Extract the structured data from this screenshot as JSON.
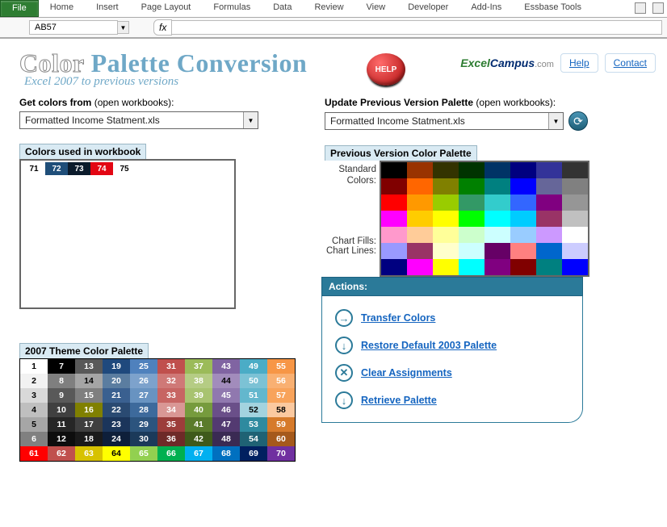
{
  "ribbon": {
    "tabs": [
      "File",
      "Home",
      "Insert",
      "Page Layout",
      "Formulas",
      "Data",
      "Review",
      "View",
      "Developer",
      "Add-Ins",
      "Essbase Tools"
    ]
  },
  "namebox": "AB57",
  "fx_label": "fx",
  "title_word1": "Color",
  "title_rest": "Palette Conversion",
  "subtitle": "Excel 2007 to previous versions",
  "help_label": "HELP",
  "brand": {
    "a": "Excel",
    "b": "Campus",
    "c": ".com"
  },
  "link_help": "Help",
  "link_contact": "Contact",
  "left": {
    "get_label_b": "Get colors from",
    "get_label_r": " (open workbooks):",
    "dd_value": "Formatted Income Statment.xls",
    "used_title": "Colors used in workbook",
    "used": [
      {
        "n": "71",
        "bg": "#ffffff",
        "fg": "#000"
      },
      {
        "n": "72",
        "bg": "#1f4e79",
        "fg": "#fff"
      },
      {
        "n": "73",
        "bg": "#0b1b2b",
        "fg": "#fff"
      },
      {
        "n": "74",
        "bg": "#e30613",
        "fg": "#fff"
      },
      {
        "n": "75",
        "bg": "#ffffff",
        "fg": "#000"
      }
    ],
    "theme_title": "2007 Theme Color Palette",
    "theme_grid": [
      [
        {
          "n": "1",
          "bg": "#ffffff",
          "dk": 1
        },
        {
          "n": "7",
          "bg": "#000000"
        },
        {
          "n": "13",
          "bg": "#595959"
        },
        {
          "n": "19",
          "bg": "#1f497d"
        },
        {
          "n": "25",
          "bg": "#4f81bd"
        },
        {
          "n": "31",
          "bg": "#c0504d"
        },
        {
          "n": "37",
          "bg": "#9bbb59"
        },
        {
          "n": "43",
          "bg": "#8064a2"
        },
        {
          "n": "49",
          "bg": "#4bacc6"
        },
        {
          "n": "55",
          "bg": "#f79646"
        }
      ],
      [
        {
          "n": "2",
          "bg": "#f2f2f2",
          "dk": 1
        },
        {
          "n": "8",
          "bg": "#7f7f7f"
        },
        {
          "n": "14",
          "bg": "#a5a5a5",
          "dk": 1
        },
        {
          "n": "20",
          "bg": "#5b7da0"
        },
        {
          "n": "26",
          "bg": "#7da2cc"
        },
        {
          "n": "32",
          "bg": "#cf7977"
        },
        {
          "n": "38",
          "bg": "#b5cc84"
        },
        {
          "n": "44",
          "bg": "#a28cbc",
          "dk": 1
        },
        {
          "n": "50",
          "bg": "#7cc2d5"
        },
        {
          "n": "56",
          "bg": "#f9b072"
        }
      ],
      [
        {
          "n": "3",
          "bg": "#d9d9d9",
          "dk": 1
        },
        {
          "n": "9",
          "bg": "#595959"
        },
        {
          "n": "15",
          "bg": "#7f7f7f"
        },
        {
          "n": "21",
          "bg": "#3a6090"
        },
        {
          "n": "27",
          "bg": "#6893c1"
        },
        {
          "n": "33",
          "bg": "#c76563"
        },
        {
          "n": "39",
          "bg": "#a8c370"
        },
        {
          "n": "45",
          "bg": "#9078af"
        },
        {
          "n": "51",
          "bg": "#63b7cd"
        },
        {
          "n": "57",
          "bg": "#f8a35b"
        }
      ],
      [
        {
          "n": "4",
          "bg": "#bfbfbf",
          "dk": 1
        },
        {
          "n": "10",
          "bg": "#404040"
        },
        {
          "n": "16",
          "bg": "#808000"
        },
        {
          "n": "22",
          "bg": "#2a4a72"
        },
        {
          "n": "28",
          "bg": "#3d6a9c"
        },
        {
          "n": "34",
          "bg": "#d99795"
        },
        {
          "n": "40",
          "bg": "#769b3d"
        },
        {
          "n": "46",
          "bg": "#6a4f89"
        },
        {
          "n": "52",
          "bg": "#a3d3df",
          "dk": 1
        },
        {
          "n": "58",
          "bg": "#fbc9a0",
          "dk": 1
        }
      ],
      [
        {
          "n": "5",
          "bg": "#a6a6a6",
          "dk": 1
        },
        {
          "n": "11",
          "bg": "#262626"
        },
        {
          "n": "17",
          "bg": "#3f3f3f"
        },
        {
          "n": "23",
          "bg": "#1b355b"
        },
        {
          "n": "29",
          "bg": "#2c547e"
        },
        {
          "n": "35",
          "bg": "#9c3d3b"
        },
        {
          "n": "41",
          "bg": "#5a7b2b"
        },
        {
          "n": "47",
          "bg": "#533a71"
        },
        {
          "n": "53",
          "bg": "#2f8a9f"
        },
        {
          "n": "59",
          "bg": "#d67a2b"
        }
      ],
      [
        {
          "n": "6",
          "bg": "#808080"
        },
        {
          "n": "12",
          "bg": "#0d0d0d"
        },
        {
          "n": "18",
          "bg": "#1a1a1a"
        },
        {
          "n": "24",
          "bg": "#0e1f3a"
        },
        {
          "n": "30",
          "bg": "#1b3a5a"
        },
        {
          "n": "36",
          "bg": "#6e2a28"
        },
        {
          "n": "42",
          "bg": "#3f5a1b"
        },
        {
          "n": "48",
          "bg": "#3a2a53"
        },
        {
          "n": "54",
          "bg": "#1f6274"
        },
        {
          "n": "60",
          "bg": "#a5591b"
        }
      ],
      [
        {
          "n": "61",
          "bg": "#ff0000"
        },
        {
          "n": "62",
          "bg": "#c0504d"
        },
        {
          "n": "63",
          "bg": "#d7c200"
        },
        {
          "n": "64",
          "bg": "#ffff00",
          "dk": 1
        },
        {
          "n": "65",
          "bg": "#92d050"
        },
        {
          "n": "66",
          "bg": "#00b050"
        },
        {
          "n": "67",
          "bg": "#00b0f0"
        },
        {
          "n": "68",
          "bg": "#0070c0"
        },
        {
          "n": "69",
          "bg": "#002060"
        },
        {
          "n": "70",
          "bg": "#7030a0"
        }
      ]
    ]
  },
  "right": {
    "upd_label_b": "Update Previous Version Palette",
    "upd_label_r": " (open workbooks):",
    "dd_value": "Formatted Income Statment.xls",
    "prev_title": "Previous Version Color Palette",
    "std_label": "Standard Colors:",
    "chartfills_label": "Chart Fills:",
    "chartlines_label": "Chart Lines:",
    "palette": {
      "standard": [
        [
          "#000000",
          "#993300",
          "#333300",
          "#003300",
          "#003366",
          "#000080",
          "#333399",
          "#333333"
        ],
        [
          "#800000",
          "#ff6600",
          "#808000",
          "#008000",
          "#008080",
          "#0000ff",
          "#666699",
          "#808080"
        ],
        [
          "#ff0000",
          "#ff9900",
          "#99cc00",
          "#339966",
          "#33cccc",
          "#3366ff",
          "#800080",
          "#969696"
        ],
        [
          "#ff00ff",
          "#ffcc00",
          "#ffff00",
          "#00ff00",
          "#00ffff",
          "#00ccff",
          "#993366",
          "#c0c0c0"
        ],
        [
          "#ff99cc",
          "#ffcc99",
          "#ffff99",
          "#ccffcc",
          "#ccffff",
          "#99ccff",
          "#cc99ff",
          "#ffffff"
        ]
      ],
      "chartfills": [
        [
          "#9999ff",
          "#993366",
          "#ffffcc",
          "#ccffff",
          "#660066",
          "#ff8080",
          "#0066cc",
          "#ccccff"
        ]
      ],
      "chartlines": [
        [
          "#000080",
          "#ff00ff",
          "#ffff00",
          "#00ffff",
          "#800080",
          "#800000",
          "#008080",
          "#0000ff"
        ]
      ]
    },
    "actions_title": "Actions:",
    "actions": [
      {
        "icon": "→",
        "label": "Transfer Colors"
      },
      {
        "icon": "↓",
        "label": "Restore Default 2003 Palette"
      },
      {
        "icon": "✕",
        "label": "Clear Assignments"
      },
      {
        "icon": "↓",
        "label": "Retrieve Palette"
      }
    ]
  }
}
